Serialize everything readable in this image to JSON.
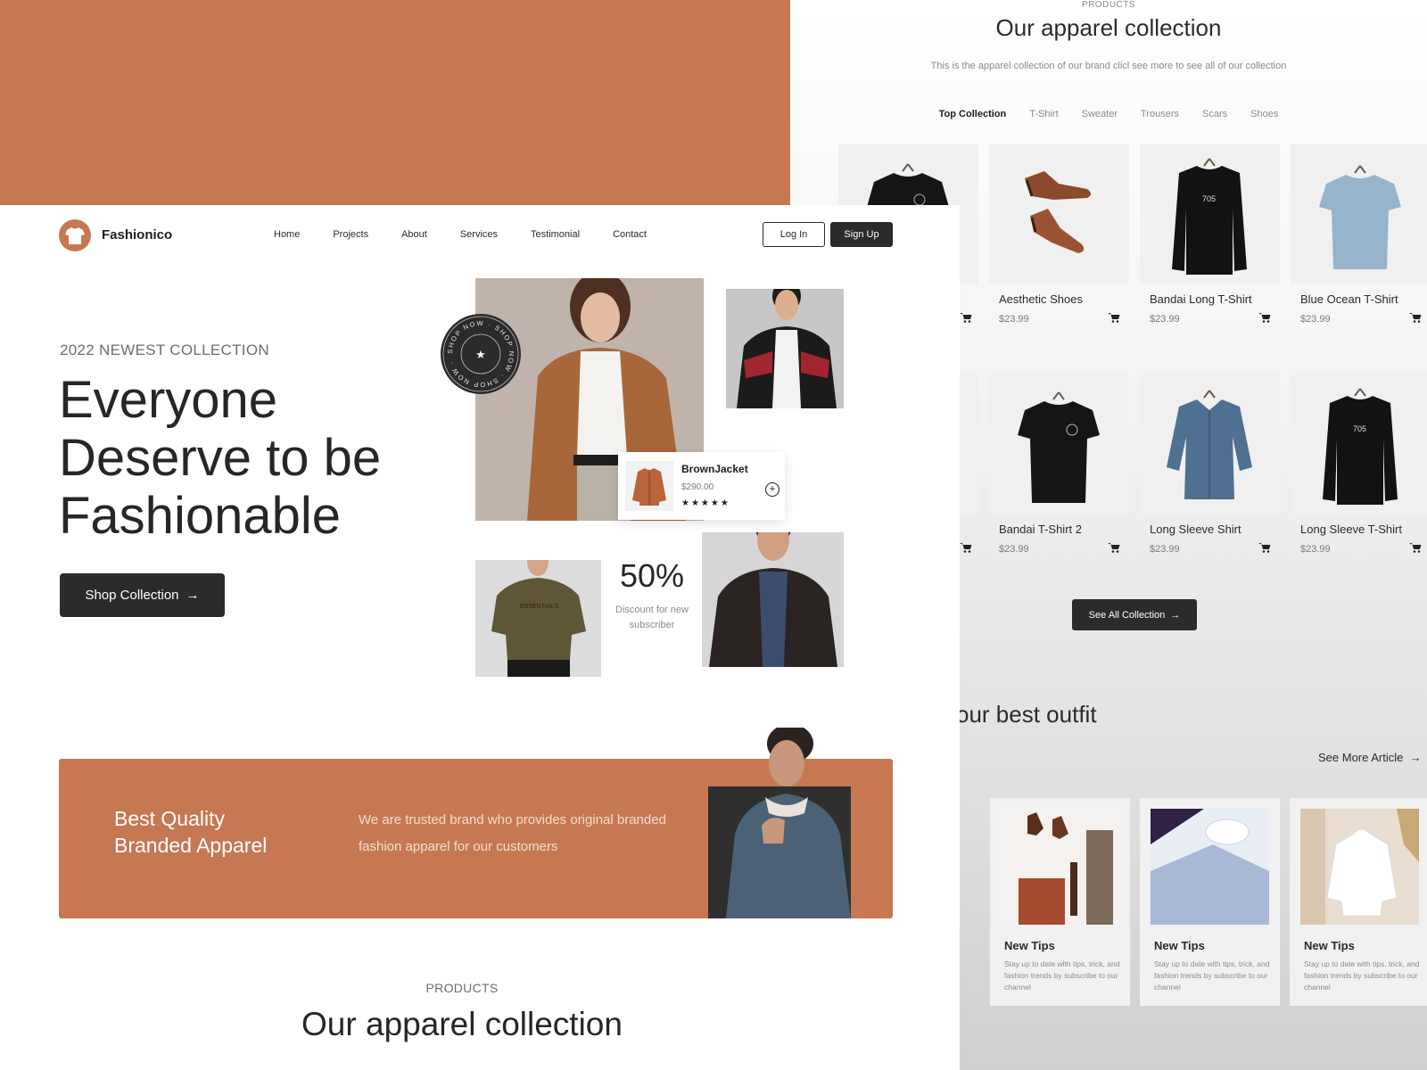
{
  "colors": {
    "accent": "#c67853",
    "dark": "#2b2b2b",
    "page": "#ffffff"
  },
  "back": {
    "eyebrow": "PRODUCTS",
    "title": "Our apparel collection",
    "subtitle": "This is the apparel collection of our brand clicl see more to see all of our collection",
    "tabs": [
      "Top Collection",
      "T-Shirt",
      "Sweater",
      "Trousers",
      "Scars",
      "Shoes"
    ],
    "products": [
      {
        "name": "Aesthetic Shoes",
        "price": "$23.99",
        "icon": "shoes"
      },
      {
        "name": "Bandai Long T-Shirt",
        "price": "$23.99",
        "icon": "long-tshirt-black"
      },
      {
        "name": "Blue Ocean T-Shirt",
        "price": "$23.99",
        "icon": "tshirt-blue"
      },
      {
        "name": "Bandai T-Shirt 2",
        "price": "$23.99",
        "icon": "tshirt-black"
      },
      {
        "name": "Long Sleeve Shirt",
        "price": "$23.99",
        "icon": "shirt-denim"
      },
      {
        "name": "Long Sleeve T-Shirt",
        "price": "$23.99",
        "icon": "long-tshirt-black"
      }
    ],
    "see_all": "See All Collection",
    "outfit_heading": "our best outfit",
    "see_more": "See More Article",
    "tips": [
      {
        "title": "New Tips",
        "text": "Stay up to date with tips, trick, and fashion trends by subscribe to our channel"
      },
      {
        "title": "New Tips",
        "text": "Stay up to date with tips, trick, and fashion trends by subscribe to our channel"
      },
      {
        "title": "New Tips",
        "text": "Stay up to date with tips, trick, and fashion trends by subscribe to our channel"
      }
    ]
  },
  "header": {
    "brand": "Fashionico",
    "nav": [
      "Home",
      "Projects",
      "About",
      "Services",
      "Testimonial",
      "Contact"
    ],
    "login": "Log In",
    "signup": "Sign Up"
  },
  "hero": {
    "eyebrow": "2022 NEWEST COLLECTION",
    "title": "Everyone Deserve to be Fashionable",
    "cta": "Shop Collection",
    "stamp_text": "SHOP NOW · SHOP NOW · SHOP NOW ·",
    "product_card": {
      "name": "BrownJacket",
      "price": "$290.00",
      "rating": 5,
      "stars": "★★★★★"
    },
    "discount": {
      "value": "50%",
      "text": "Discount for new subscriber"
    }
  },
  "banner": {
    "title_line1": "Best Quality",
    "title_line2": "Branded Apparel",
    "text": "We are trusted  brand who provides original branded fashion apparel for our customers"
  },
  "products": {
    "eyebrow": "PRODUCTS",
    "title": "Our apparel collection"
  }
}
